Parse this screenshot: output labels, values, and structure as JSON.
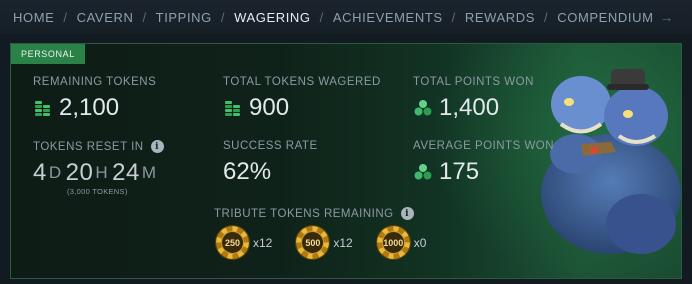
{
  "nav": {
    "items": [
      "HOME",
      "CAVERN",
      "TIPPING",
      "WAGERING",
      "ACHIEVEMENTS",
      "REWARDS",
      "COMPENDIUM"
    ],
    "active": "WAGERING",
    "separator": "/"
  },
  "panel": {
    "tag": "PERSONAL",
    "remaining": {
      "label": "REMAINING TOKENS",
      "value": "2,100",
      "icon": "token-stack-icon"
    },
    "wagered": {
      "label": "TOTAL TOKENS WAGERED",
      "value": "900",
      "icon": "token-stack-icon"
    },
    "points": {
      "label": "TOTAL POINTS WON",
      "value": "1,400",
      "icon": "points-gem-icon"
    },
    "reset": {
      "label": "TOKENS RESET IN",
      "days": "4",
      "days_unit": "D",
      "hours": "20",
      "hours_unit": "H",
      "minutes": "24",
      "minutes_unit": "M",
      "sub": "(3,000 TOKENS)"
    },
    "success": {
      "label": "SUCCESS RATE",
      "value": "62%"
    },
    "average": {
      "label": "AVERAGE POINTS WON",
      "value": "175",
      "icon": "points-gem-icon"
    },
    "tribute": {
      "label": "TRIBUTE TOKENS REMAINING",
      "chips": [
        {
          "value": "250",
          "count": "x12"
        },
        {
          "value": "500",
          "count": "x12"
        },
        {
          "value": "1000",
          "count": "x0"
        }
      ]
    }
  },
  "colors": {
    "accent_green": "#2b8248",
    "chip_gold": "#e8b93a",
    "token_green": "#3fc26a"
  }
}
